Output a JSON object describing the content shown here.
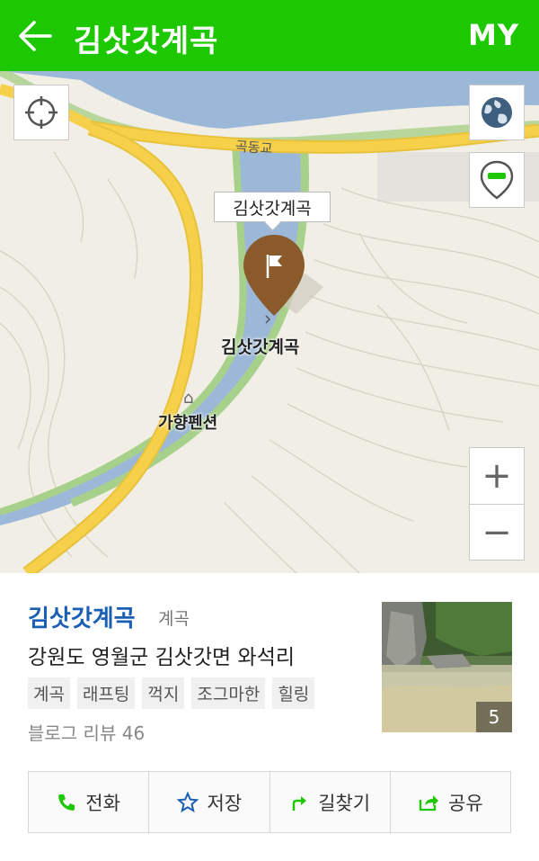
{
  "header": {
    "title": "김삿갓계곡",
    "my_label": "MY",
    "bg_color": "#1ec800"
  },
  "map": {
    "road_label": "곡동교",
    "callout_label": "김삿갓계곡",
    "pin_label": "김삿갓계곡",
    "poi_label": "가향펜션",
    "zoom_in_label": "+",
    "zoom_out_label": "−",
    "pin_color": "#8b5a2b",
    "water_color": "#9cb8d8",
    "road_color": "#f7d04a"
  },
  "place": {
    "name": "김삿갓계곡",
    "category": "계곡",
    "address": "강원도 영월군 김삿갓면 와석리",
    "tags": [
      "계곡",
      "래프팅",
      "꺽지",
      "조그마한",
      "힐링"
    ],
    "reviews": "블로그 리뷰 46",
    "photo_count": "5"
  },
  "actions": [
    {
      "label": "전화",
      "icon": "phone-icon",
      "color": "#1ec800"
    },
    {
      "label": "저장",
      "icon": "star-icon",
      "color": "#1a5fb4"
    },
    {
      "label": "길찾기",
      "icon": "directions-icon",
      "color": "#1ec800"
    },
    {
      "label": "공유",
      "icon": "share-icon",
      "color": "#1ec800"
    }
  ]
}
